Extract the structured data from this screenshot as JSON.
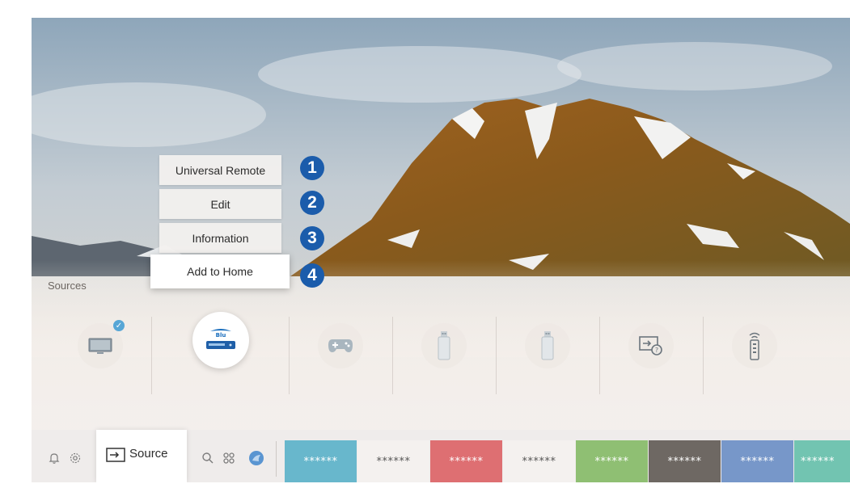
{
  "context_menu": {
    "items": [
      {
        "label": "Universal Remote",
        "callout": "1"
      },
      {
        "label": "Edit",
        "callout": "2"
      },
      {
        "label": "Information",
        "callout": "3"
      },
      {
        "label": "Add to Home",
        "callout": "4",
        "focused": true
      }
    ]
  },
  "sources": {
    "label": "Sources",
    "items": [
      {
        "icon": "tv-monitor-icon",
        "checked": true
      },
      {
        "icon": "blu-ray-player-icon",
        "selected": true
      },
      {
        "icon": "game-controller-icon"
      },
      {
        "icon": "usb-drive-icon"
      },
      {
        "icon": "usb-drive-icon"
      },
      {
        "icon": "connection-guide-icon"
      },
      {
        "icon": "universal-remote-icon"
      }
    ]
  },
  "bottom_bar": {
    "icons": [
      "notification-bell-icon",
      "settings-gear-icon",
      "search-icon",
      "apps-icon",
      "ambient-mode-icon"
    ],
    "source_label": "Source",
    "tiles": [
      {
        "text": "******",
        "bg": "#68b7cc",
        "fg": "#ffffff"
      },
      {
        "text": "******",
        "bg": "#f4f1ef",
        "fg": "#555555"
      },
      {
        "text": "******",
        "bg": "#de6f72",
        "fg": "#ffffff"
      },
      {
        "text": "******",
        "bg": "#f4f1ef",
        "fg": "#555555"
      },
      {
        "text": "******",
        "bg": "#8fbf73",
        "fg": "#ffffff"
      },
      {
        "text": "******",
        "bg": "#6e6863",
        "fg": "#ffffff"
      },
      {
        "text": "******",
        "bg": "#7797c9",
        "fg": "#ffffff"
      },
      {
        "text": "******",
        "bg": "#72c4b1",
        "fg": "#ffffff"
      }
    ]
  },
  "colors": {
    "callout": "#1b5cab",
    "menu_bg": "#f3f1ef",
    "bar_bg": "#efeceb"
  }
}
